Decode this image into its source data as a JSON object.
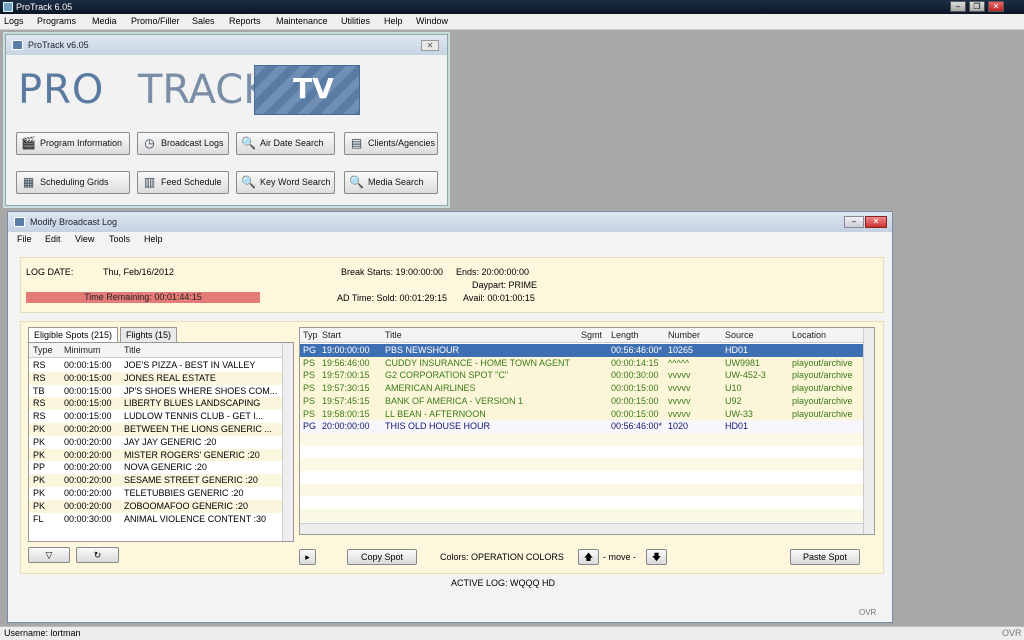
{
  "app": {
    "title": "ProTrack 6.05",
    "menu": [
      "Logs",
      "Programs",
      "Media",
      "Promo/Filler",
      "Sales",
      "Reports",
      "Maintenance",
      "Utilities",
      "Help",
      "Window"
    ]
  },
  "launcher": {
    "title": "ProTrack v6.05",
    "logo_pro": "PRO",
    "logo_track": "TRACK",
    "logo_tv": "TV",
    "buttons": [
      "Program Information",
      "Broadcast Logs",
      "Air Date Search",
      "Clients/Agencies",
      "Scheduling Grids",
      "Feed Schedule",
      "Key Word Search",
      "Media Search"
    ]
  },
  "modify": {
    "title": "Modify Broadcast Log",
    "menu": [
      "File",
      "Edit",
      "View",
      "Tools",
      "Help"
    ],
    "log_date_label": "LOG DATE:",
    "log_date": "Thu, Feb/16/2012",
    "time_remaining": "Time Remaining: 00:01:44:15",
    "break_starts": "Break Starts: 19:00:00:00",
    "ends": "Ends:    20:00:00:00",
    "daypart": "Daypart: PRIME",
    "ad_time": "AD Time:  Sold: 00:01:29:15",
    "avail": "Avail: 00:01:00:15",
    "tab_eligible": "Eligible Spots (215)",
    "tab_flights": "Flights (15)",
    "left_headers": [
      "Type",
      "Minimum",
      "Title"
    ],
    "spots": [
      [
        "RS",
        "00:00:15:00",
        "JOE'S PIZZA - BEST IN VALLEY"
      ],
      [
        "RS",
        "00:00:15:00",
        "JONES REAL ESTATE"
      ],
      [
        "TB",
        "00:00:15:00",
        "JP'S SHOES WHERE SHOES COM..."
      ],
      [
        "RS",
        "00:00:15:00",
        "LIBERTY BLUES LANDSCAPING"
      ],
      [
        "RS",
        "00:00:15:00",
        "LUDLOW TENNIS CLUB - GET I..."
      ],
      [
        "PK",
        "00:00:20:00",
        "BETWEEN THE LIONS GENERIC ..."
      ],
      [
        "PK",
        "00:00:20:00",
        "JAY JAY GENERIC :20"
      ],
      [
        "PK",
        "00:00:20:00",
        "MISTER ROGERS' GENERIC :20"
      ],
      [
        "PP",
        "00:00:20:00",
        "NOVA GENERIC :20"
      ],
      [
        "PK",
        "00:00:20:00",
        "SESAME STREET GENERIC :20"
      ],
      [
        "PK",
        "00:00:20:00",
        "TELETUBBIES GENERIC :20"
      ],
      [
        "PK",
        "00:00:20:00",
        "ZOBOOMAFOO GENERIC :20"
      ],
      [
        "FL",
        "00:00:30:00",
        "ANIMAL VIOLENCE CONTENT :30"
      ]
    ],
    "right_headers": [
      "Typ",
      "Start",
      "Title",
      "Sgmt",
      "Length",
      "Number",
      "Source",
      "Location"
    ],
    "log_rows": [
      [
        "PG",
        "19:00:00:00",
        "PBS NEWSHOUR",
        "",
        "00:56:46:00*",
        "10265",
        "HD01",
        ""
      ],
      [
        "PS",
        "19:56:46:00",
        "CUDDY INSURANCE - HOME TOWN AGENT",
        "",
        "00:00:14:15",
        "^^^^^",
        "UW9981",
        "playout/archive"
      ],
      [
        "PS",
        "19:57:00:15",
        "G2 CORPORATION SPOT \"C\"",
        "",
        "00:00:30:00",
        "vvvvv",
        "UW-452-3",
        "playout/archive"
      ],
      [
        "PS",
        "19:57:30:15",
        "AMERICAN AIRLINES",
        "",
        "00:00:15:00",
        "vvvvv",
        "U10",
        "playout/archive"
      ],
      [
        "PS",
        "19:57:45:15",
        "BANK OF AMERICA - VERSION 1",
        "",
        "00:00:15:00",
        "vvvvv",
        "U92",
        "playout/archive"
      ],
      [
        "PS",
        "19:58:00:15",
        "LL BEAN - AFTERNOON",
        "",
        "00:00:15:00",
        "vvvvv",
        "UW-33",
        "playout/archive"
      ],
      [
        "PG",
        "20:00:00:00",
        "THIS OLD HOUSE HOUR",
        "",
        "00:56:46:00*",
        "1020",
        "HD01",
        ""
      ]
    ],
    "copy_spot": "Copy Spot",
    "colors": "Colors: OPERATION COLORS",
    "move": "- move -",
    "paste_spot": "Paste Spot",
    "active_log": "ACTIVE LOG: WQQQ HD",
    "ovr": "OVR"
  },
  "status": {
    "username": "Username: lortman",
    "ovr": "OVR"
  },
  "colors": {
    "selected_row": "#3e6fb3",
    "ps_text": "#3a7a1a",
    "pg_text": "#16166e",
    "time_bar": "#e57b77",
    "panel": "#fdf7dd"
  }
}
